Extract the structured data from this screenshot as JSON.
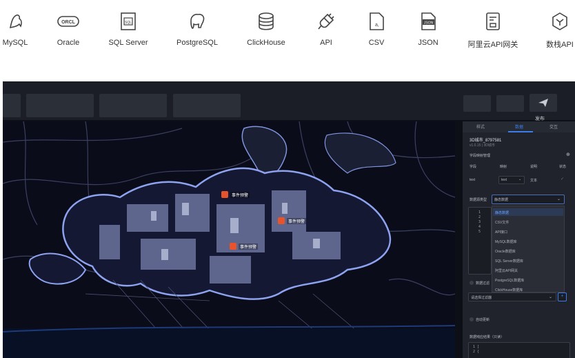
{
  "sources": [
    {
      "label": "MySQL",
      "icon": "dolphin-icon"
    },
    {
      "label": "Oracle",
      "icon": "oracle-icon"
    },
    {
      "label": "SQL Server",
      "icon": "sql-file-icon"
    },
    {
      "label": "PostgreSQL",
      "icon": "elephant-icon"
    },
    {
      "label": "ClickHouse",
      "icon": "database-icon"
    },
    {
      "label": "API",
      "icon": "plug-icon"
    },
    {
      "label": "CSV",
      "icon": "csv-file-icon"
    },
    {
      "label": "JSON",
      "icon": "json-file-icon"
    },
    {
      "label": "阿里云API网关",
      "icon": "gateway-icon"
    },
    {
      "label": "数栈API",
      "icon": "hexagon-icon"
    }
  ],
  "toolbar": {
    "publish_label": "发布"
  },
  "map": {
    "pins": [
      {
        "label": "事件预警"
      },
      {
        "label": "事件预警"
      },
      {
        "label": "事件预警"
      }
    ]
  },
  "panel": {
    "tabs": [
      "样式",
      "数据",
      "交互"
    ],
    "component_name": "3D城市_8797581",
    "version": "v1.0.15 | 3D城市",
    "field_section": "字段映射管理",
    "columns": [
      "字段",
      "映射",
      "说明",
      "状态"
    ],
    "row": {
      "field": "text",
      "mapping": "text",
      "desc": "文本"
    },
    "source_type_label": "数据源类型",
    "source_type_value": "静态数据",
    "options": [
      "静态数据",
      "CSV文件",
      "API接口",
      "MySQL数据库",
      "Oracle数据库",
      "SQL Server数据库",
      "阿里云API网关",
      "PostgreSQL数据库",
      "ClickHouse数据库"
    ],
    "code_lines": [
      "1",
      "2",
      "3",
      "4",
      "5"
    ],
    "filter_label": "数据过滤",
    "filter_placeholder": "请选择过滤器",
    "auto_update": "自动更新",
    "response_label": "数据响应结果（只读）",
    "response_lines": [
      "1 [",
      "2   {"
    ]
  }
}
